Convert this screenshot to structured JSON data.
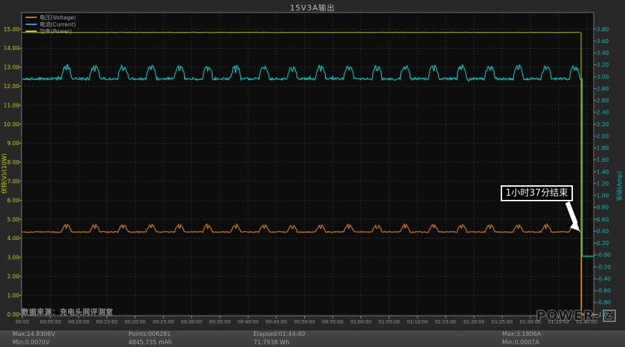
{
  "window": {
    "title": "15V3A输出"
  },
  "legend": {
    "items": [
      {
        "label": "电压(Voltage)",
        "color": "#c8831e"
      },
      {
        "label": "电流(Current)",
        "color": "#3a9ad9"
      },
      {
        "label": "功率(Power)",
        "color": "#cdcd00"
      }
    ]
  },
  "annotation": {
    "text": "1小时37分结束"
  },
  "watermark": {
    "source_text": "数据来源：充电头网评测室",
    "brand_prefix": "POWER-",
    "brand_z": "Z"
  },
  "status_bar": {
    "voltage_max": "Max:14.8306V",
    "voltage_min": "Min:0.0070V",
    "points": "Points:006281",
    "capacity": "4845.735 mAh",
    "elapsed": "Elapsed:01:44:40",
    "energy": "71.7938 Wh",
    "current_max": "Max:3.1806A",
    "current_min": "Min:0.0007A"
  },
  "chart_data": {
    "type": "line",
    "title": "15V3A输出",
    "grid": true,
    "legend_position": "top-left",
    "x_ticks": [
      "00:00",
      "00:05:00",
      "00:10:00",
      "00:15:00",
      "00:20:00",
      "00:25:00",
      "00:30:00",
      "00:35:00",
      "00:40:00",
      "00:45:00",
      "00:50:00",
      "00:55:00",
      "01:00:00",
      "01:05:00",
      "01:10:00",
      "01:15:00",
      "01:20:00",
      "01:25:00",
      "01:30:00",
      "01:35:00",
      "01:40:00"
    ],
    "y_left": {
      "label": "伏特(V)/(10W)",
      "color": "#cdcd00",
      "tick_step": 1.0,
      "ticks": [
        "15.00",
        "14.00",
        "13.00",
        "12.00",
        "11.00",
        "10.00",
        "9.00",
        "8.00",
        "7.00",
        "6.00",
        "5.00",
        "4.00",
        "3.00",
        "2.00",
        "1.00",
        "0.00"
      ]
    },
    "y_right": {
      "label": "安培(Amp)",
      "color": "#00c3c3",
      "tick_step": 0.2,
      "ticks": [
        "3.80",
        "3.60",
        "3.40",
        "3.20",
        "3.00",
        "2.80",
        "2.60",
        "2.40",
        "2.20",
        "2.00",
        "1.80",
        "1.60",
        "1.40",
        "1.20",
        "1.00",
        "0.80",
        "0.60",
        "0.40",
        "0.20",
        "-0.00",
        "-0.20",
        "-0.40",
        "-0.60",
        "-0.80",
        "-1.00"
      ]
    },
    "series": [
      {
        "name": "电压(Voltage)",
        "axis": "left",
        "unit": "V",
        "color": "#b5b500",
        "steady_value": 14.83,
        "max": 14.8306,
        "min": 0.007,
        "end_value": 0
      },
      {
        "name": "电流(Current)",
        "axis": "right",
        "unit": "A",
        "color": "#00dfdf",
        "baseline": 2.97,
        "burst_peak": 3.16,
        "first_burst_min": 7,
        "burst_period_min": 5,
        "burst_width_min": 1.7,
        "max": 3.1806,
        "min": 0.0007,
        "end_value": -0.02
      },
      {
        "name": "功率(Power)",
        "axis": "left",
        "unit": "10W",
        "color": "#ff8a00",
        "baseline": 4.34,
        "burst_peak": 4.72,
        "first_burst_min": 7,
        "burst_period_min": 5,
        "burst_width_min": 1.7,
        "end_value": 0
      }
    ],
    "end_min": 99.0,
    "duration_shown_min": 101.2
  }
}
